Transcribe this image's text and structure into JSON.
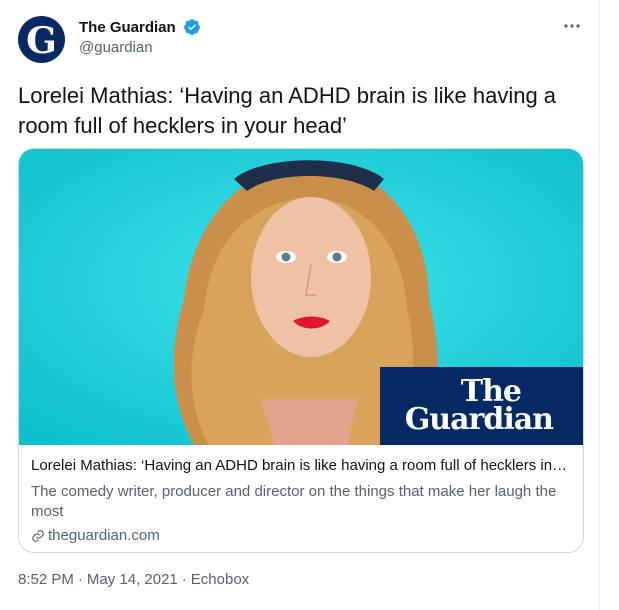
{
  "account": {
    "avatar_letter": "G",
    "display_name": "The Guardian",
    "handle": "@guardian",
    "verified": true
  },
  "icons": {
    "verified": "verified-badge-icon",
    "more": "more-options-icon",
    "link": "link-icon"
  },
  "tweet": {
    "text": "Lorelei Mathias: ‘Having an ADHD brain is like having a room full of hecklers in your head’"
  },
  "card": {
    "logo_line1": "The",
    "logo_line2": "Guardian",
    "title": "Lorelei Mathias: ‘Having an ADHD brain is like having a room full of hecklers in your head’",
    "description": "The comedy writer, producer and director on the things that make her laugh the most",
    "domain": "theguardian.com"
  },
  "meta": {
    "time": "8:52 PM",
    "separator": "·",
    "date": "May 14, 2021",
    "source": "Echobox"
  },
  "colors": {
    "accent": "#1d9bf0",
    "guardian_navy": "#052962",
    "image_background": "#12c9d3",
    "secondary_text": "#536471"
  }
}
